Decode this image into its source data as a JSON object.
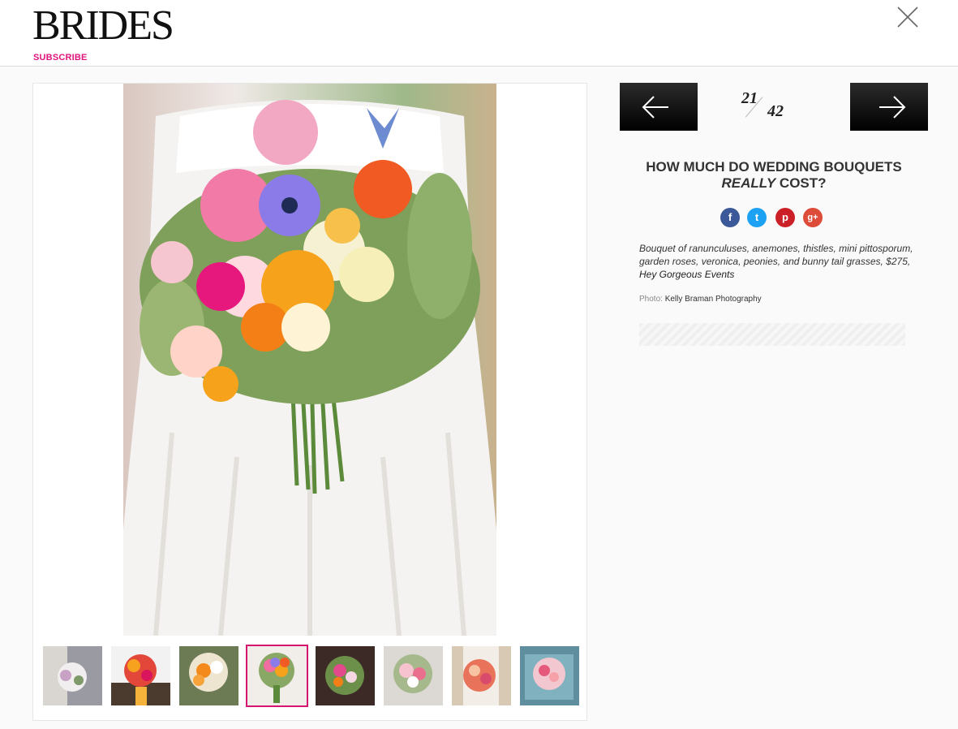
{
  "header": {
    "logo": "BRIDES",
    "subscribe": "SUBSCRIBE"
  },
  "counter": {
    "current": "21",
    "total": "42"
  },
  "article": {
    "title_part1": "HOW MUCH DO WEDDING BOUQUETS ",
    "title_em": "REALLY",
    "title_part2": " COST?"
  },
  "social": {
    "facebook": "f",
    "twitter": "t",
    "pinterest": "p",
    "googleplus": "g+",
    "colors": {
      "facebook": "#3b5998",
      "twitter": "#1da1f2",
      "pinterest": "#cb2027",
      "googleplus": "#dd4b39"
    }
  },
  "caption": {
    "text": "Bouquet of ranunculuses, anemones, thistles, mini pittosporum, garden roses, veronica, peonies, and bunny tail grasses, $275, ",
    "link": "Hey Gorgeous Events"
  },
  "credit": {
    "label": "Photo: ",
    "name": "Kelly Braman Photography"
  },
  "colors": {
    "accent": "#e0157e",
    "active_thumb_border": "#d5156f"
  },
  "icons": {
    "close": "close-icon",
    "prev": "arrow-left-icon",
    "next": "arrow-right-icon"
  }
}
